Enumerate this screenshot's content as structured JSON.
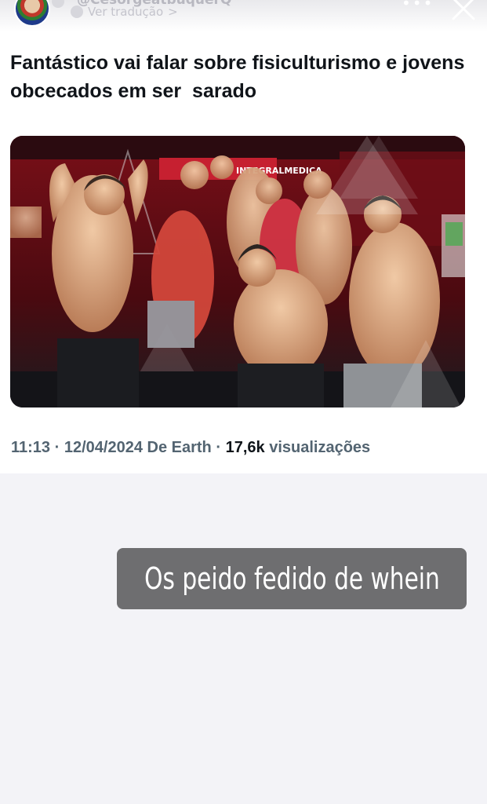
{
  "header": {
    "username": "@CesorgeatbuquerQ",
    "translate_label": "Ver tradução",
    "translate_chevron": ">"
  },
  "post": {
    "headline": "Fantástico vai falar sobre fisiculturismo e jovens obcecados em ser  sarado",
    "time": "11:13",
    "date": "12/04/2024",
    "source": "De Earth",
    "separator": "·",
    "views_count": "17,6k",
    "views_label": "visualizações",
    "image_banner_text": "INTEGRALMEDICA"
  },
  "story": {
    "caption": "Os peido fedido de whein"
  },
  "colors": {
    "caption_bg": "#6e6e70",
    "meta_text": "#536471",
    "headline_text": "#101419"
  }
}
